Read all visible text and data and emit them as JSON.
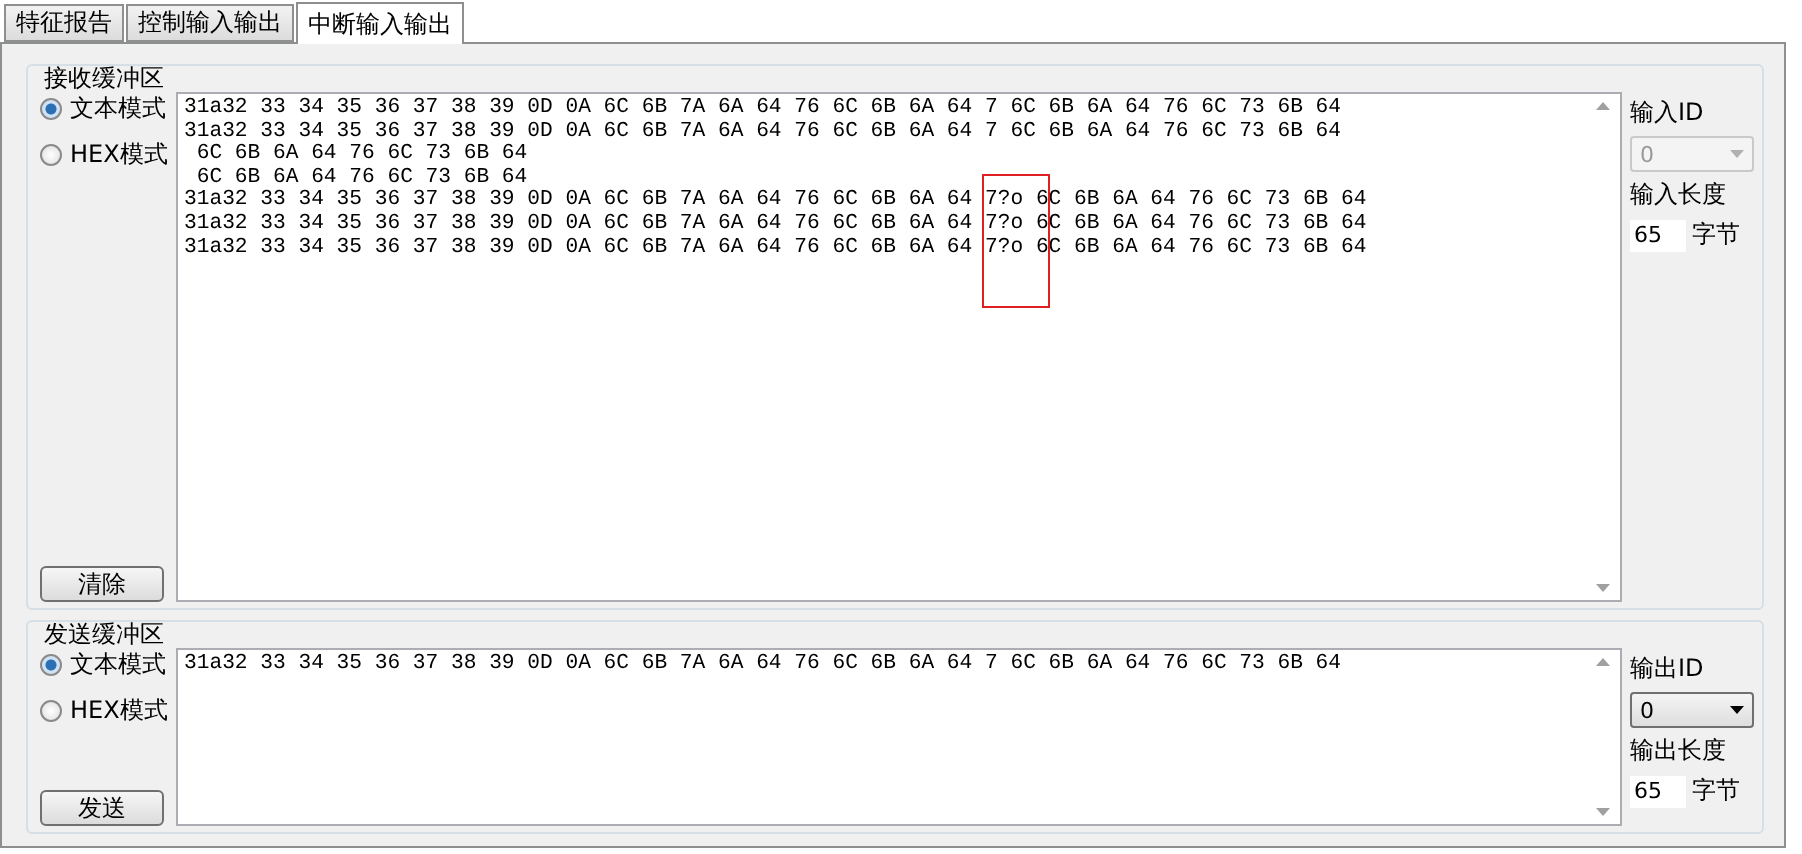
{
  "tabs": [
    {
      "label": "特征报告",
      "selected": false
    },
    {
      "label": "控制输入输出",
      "selected": false
    },
    {
      "label": "中断输入输出",
      "selected": true
    }
  ],
  "groups": [
    {
      "title": "接收缓冲区",
      "modes": [
        {
          "label": "文本模式",
          "selected": true
        },
        {
          "label": "HEX模式",
          "selected": false
        }
      ],
      "button": "清除",
      "lines": [
        "31a32 33 34 35 36 37 38 39 0D 0A 6C 6B 7A 6A 64 76 6C 6B 6A 64 7 6C 6B 6A 64 76 6C 73 6B 64",
        "31a32 33 34 35 36 37 38 39 0D 0A 6C 6B 7A 6A 64 76 6C 6B 6A 64 7 6C 6B 6A 64 76 6C 73 6B 64",
        " 6C 6B 6A 64 76 6C 73 6B 64",
        " 6C 6B 6A 64 76 6C 73 6B 64",
        "31a32 33 34 35 36 37 38 39 0D 0A 6C 6B 7A 6A 64 76 6C 6B 6A 64 7?o 6C 6B 6A 64 76 6C 73 6B 64",
        "31a32 33 34 35 36 37 38 39 0D 0A 6C 6B 7A 6A 64 76 6C 6B 6A 64 7?o 6C 6B 6A 64 76 6C 73 6B 64",
        "31a32 33 34 35 36 37 38 39 0D 0A 6C 6B 7A 6A 64 76 6C 6B 6A 64 7?o 6C 6B 6A 64 76 6C 73 6B 64"
      ],
      "highlight": true,
      "id_label": "输入ID",
      "id_value": "0",
      "id_disabled": true,
      "length_label": "输入长度",
      "length_value": "65",
      "length_unit": "字节"
    },
    {
      "title": "发送缓冲区",
      "modes": [
        {
          "label": "文本模式",
          "selected": true
        },
        {
          "label": "HEX模式",
          "selected": false
        }
      ],
      "button": "发送",
      "lines": [
        "31a32 33 34 35 36 37 38 39 0D 0A 6C 6B 7A 6A 64 76 6C 6B 6A 64 7 6C 6B 6A 64 76 6C 73 6B 64"
      ],
      "highlight": false,
      "id_label": "输出ID",
      "id_value": "0",
      "id_disabled": false,
      "length_label": "输出长度",
      "length_value": "65",
      "length_unit": "字节"
    }
  ]
}
